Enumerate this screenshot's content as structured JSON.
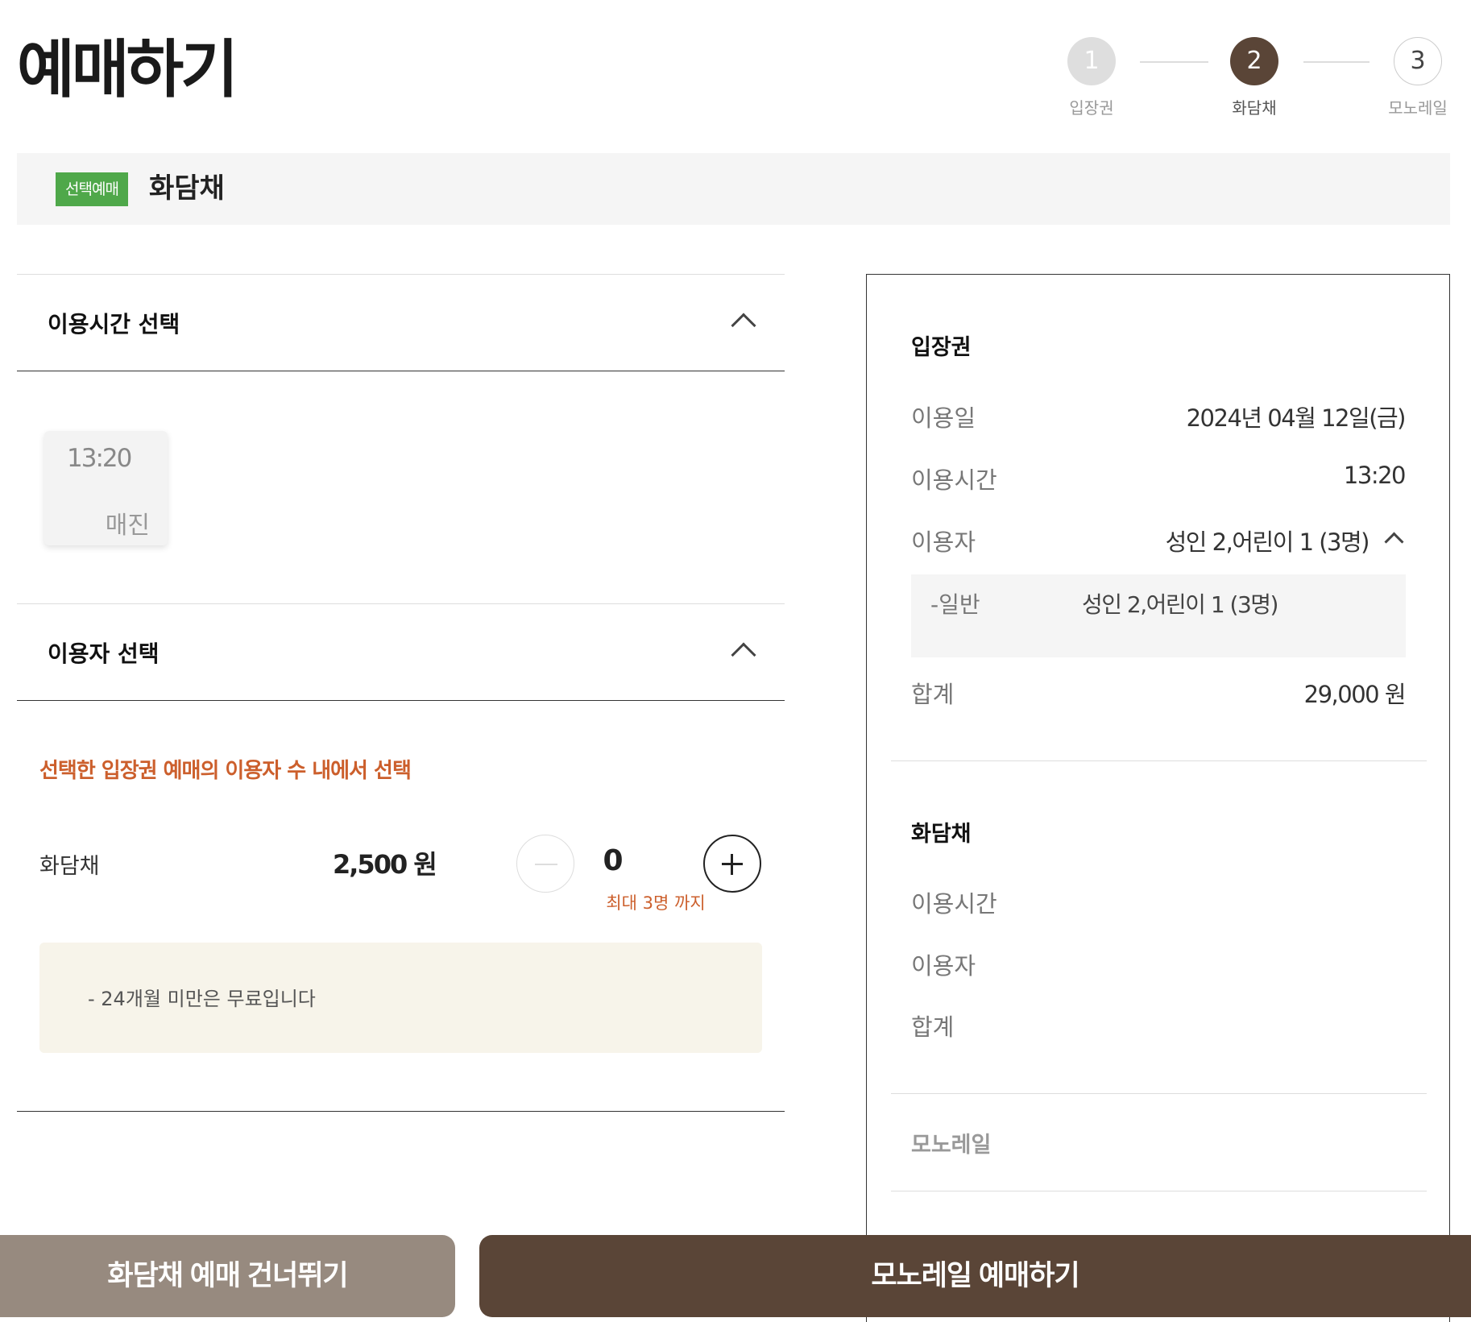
{
  "page": {
    "title": "예매하기"
  },
  "steps": [
    {
      "num": "1",
      "label": "입장권",
      "state": "done"
    },
    {
      "num": "2",
      "label": "화담채",
      "state": "active"
    },
    {
      "num": "3",
      "label": "모노레일",
      "state": "todo"
    }
  ],
  "banner": {
    "badge": "선택예매",
    "title": "화담채"
  },
  "time_section": {
    "title": "이용시간 선택",
    "slots": [
      {
        "time": "13:20",
        "status": "매진"
      }
    ]
  },
  "user_section": {
    "title": "이용자 선택",
    "notice": "선택한 입장권 예매의 이용자 수 내에서 선택",
    "item": {
      "label": "화담채",
      "price": "2,500 원",
      "quantity": "0",
      "max_note": "최대 3명 까지"
    },
    "info": "-  24개월 미만은 무료입니다"
  },
  "summary": {
    "ticket": {
      "title": "입장권",
      "date_label": "이용일",
      "date_value": "2024년 04월 12일(금)",
      "time_label": "이용시간",
      "time_value": "13:20",
      "users_label": "이용자",
      "users_value": "성인 2,어린이 1 (3명)",
      "sub_label": "-일반",
      "sub_value": "성인 2,어린이 1 (3명)",
      "total_label": "합계",
      "total_value": "29,000 원"
    },
    "hwadamchae": {
      "title": "화담채",
      "time_label": "이용시간",
      "users_label": "이용자",
      "total_label": "합계"
    },
    "monorail": {
      "title": "모노레일"
    }
  },
  "footer": {
    "skip_label": "화담채 예매 건너뛰기",
    "next_label": "모노레일 예매하기"
  },
  "colors": {
    "brand_brown": "#5a4537",
    "muted_brown": "#978a7f",
    "accent_orange": "#cc5f2c",
    "badge_green": "#4fa84a"
  }
}
